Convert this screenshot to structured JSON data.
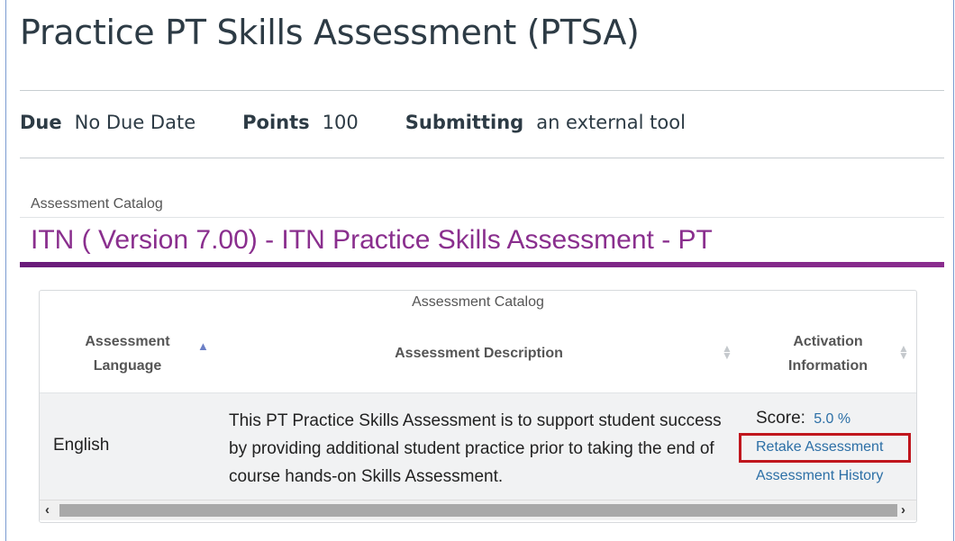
{
  "page": {
    "title": "Practice PT Skills Assessment (PTSA)"
  },
  "details": {
    "due_label": "Due",
    "due_value": "No Due Date",
    "points_label": "Points",
    "points_value": "100",
    "submitting_label": "Submitting",
    "submitting_value": "an external tool"
  },
  "catalog": {
    "caption": "Assessment Catalog",
    "title": "ITN ( Version 7.00) - ITN Practice Skills Assessment - PT"
  },
  "table": {
    "caption": "Assessment Catalog",
    "columns": [
      {
        "label": "Assessment Language",
        "line1": "Assessment",
        "line2": "Language"
      },
      {
        "label": "Assessment Description"
      },
      {
        "label": "Activation Information",
        "line1": "Activation",
        "line2": "Information"
      }
    ],
    "rows": [
      {
        "language": "English",
        "description": "This PT Practice Skills Assessment is to support student success by providing additional student practice prior to taking the end of course hands-on Skills Assessment.",
        "score_label": "Score:",
        "score_value": "5.0 %",
        "retake_label": "Retake Assessment",
        "history_label": "Assessment History"
      }
    ]
  },
  "colors": {
    "accent": "#8a2f8e",
    "link": "#2c6fa6",
    "highlight": "#c0161d"
  },
  "icons": {
    "sort_asc": "sort-ascending-icon",
    "sort_both": "sort-icon",
    "scroll_left": "chevron-left-icon",
    "scroll_right": "chevron-right-icon"
  }
}
